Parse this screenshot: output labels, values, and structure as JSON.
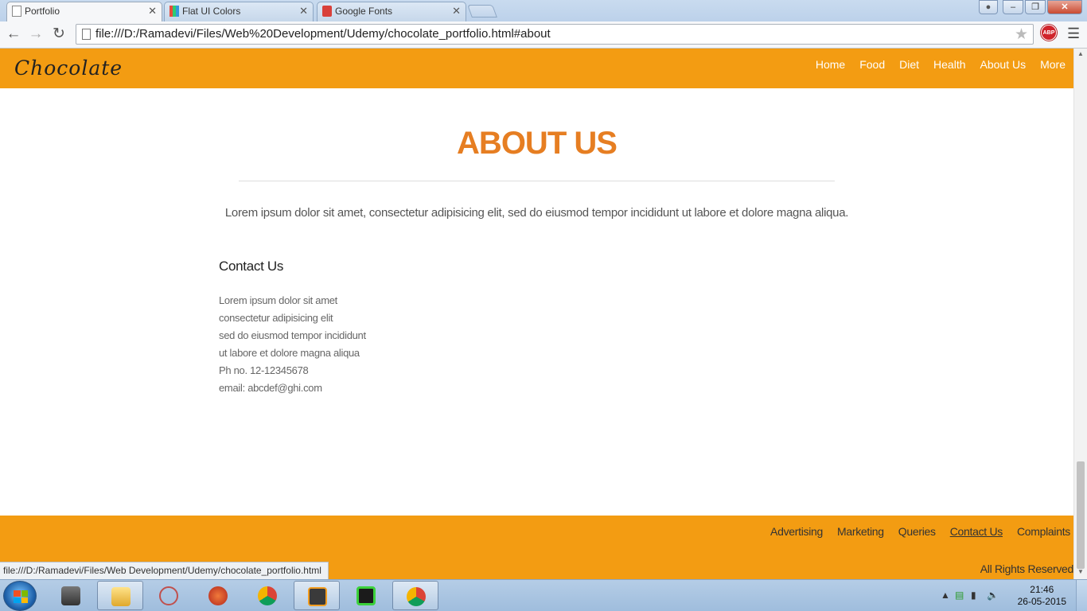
{
  "browser": {
    "tabs": [
      {
        "title": "Portfolio",
        "active": true
      },
      {
        "title": "Flat UI Colors",
        "active": false
      },
      {
        "title": "Google Fonts",
        "active": false
      }
    ],
    "url": "file:///D:/Ramadevi/Files/Web%20Development/Udemy/chocolate_portfolio.html#about",
    "status_url": "file:///D:/Ramadevi/Files/Web Development/Udemy/chocolate_portfolio.html",
    "abp_label": "ABP"
  },
  "site": {
    "logo": "Chocolate",
    "nav": [
      "Home",
      "Food",
      "Diet",
      "Health",
      "About Us",
      "More"
    ],
    "about": {
      "title": "ABOUT US",
      "lead": "Lorem ipsum dolor sit amet, consectetur adipisicing elit, sed do eiusmod tempor incididunt ut labore et dolore magna aliqua."
    },
    "contact": {
      "heading": "Contact Us",
      "lines": [
        "Lorem ipsum dolor sit amet",
        "consectetur adipisicing elit",
        "sed do eiusmod tempor incididunt",
        "ut labore et dolore magna aliqua",
        "Ph no. 12-12345678",
        "email: abcdef@ghi.com"
      ]
    },
    "footer": {
      "links": [
        "Advertising",
        "Marketing",
        "Queries",
        "Contact Us",
        "Complaints"
      ],
      "rights": "All Rights Reserved"
    },
    "colors": {
      "brand_orange": "#f39c12",
      "title_orange": "#e67e22"
    }
  },
  "taskbar": {
    "time": "21:46",
    "date": "26-05-2015"
  }
}
